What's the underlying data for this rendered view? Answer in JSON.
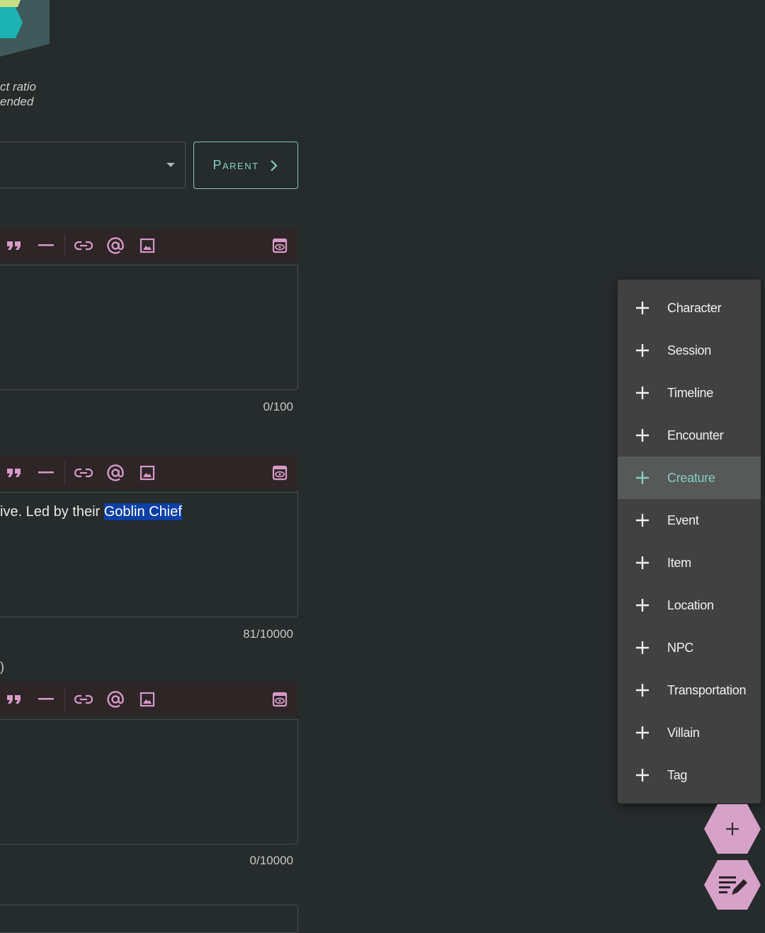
{
  "image_area": {
    "aspect_note_line1": "ct ratio",
    "aspect_note_line2": "ended"
  },
  "parent": {
    "select_value": "",
    "button_label": "Parent"
  },
  "editors": [
    {
      "counter": "0/100",
      "text": "",
      "highlight": ""
    },
    {
      "counter": "81/10000",
      "text": "ive. Led by their ",
      "highlight": "Goblin Chief"
    },
    {
      "counter": "0/10000",
      "text": "",
      "highlight": ""
    }
  ],
  "stray_char": ")",
  "toolbar_icons": [
    "quote-icon",
    "horizontal-rule-icon",
    "link-icon",
    "mention-icon",
    "image-icon",
    "preview-icon"
  ],
  "add_menu": {
    "items": [
      {
        "label": "Character"
      },
      {
        "label": "Session"
      },
      {
        "label": "Timeline"
      },
      {
        "label": "Encounter"
      },
      {
        "label": "Creature",
        "active": true
      },
      {
        "label": "Event"
      },
      {
        "label": "Item"
      },
      {
        "label": "Location"
      },
      {
        "label": "NPC"
      },
      {
        "label": "Transportation"
      },
      {
        "label": "Villain"
      },
      {
        "label": "Tag"
      }
    ],
    "accent_color": "#86cbc0"
  },
  "fab": {
    "add_icon": "plus-icon",
    "edit_icon": "notes-edit-icon",
    "color": "#d6a2c8"
  }
}
